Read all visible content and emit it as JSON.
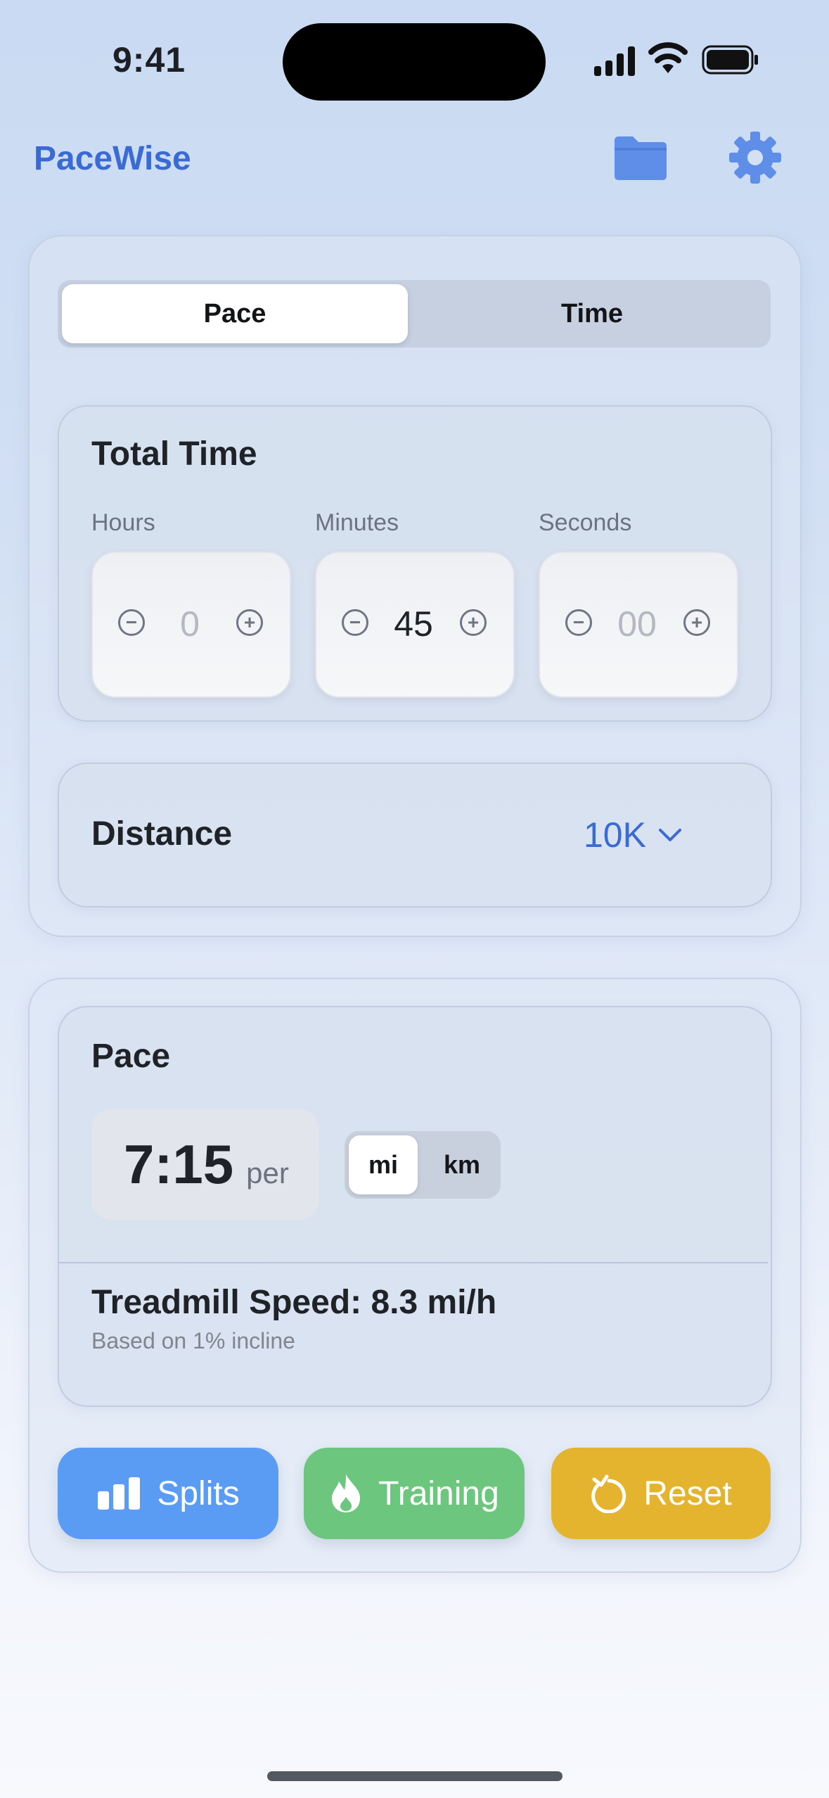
{
  "status": {
    "time": "9:41"
  },
  "header": {
    "app_title": "PaceWise",
    "folder_icon": "folder-icon",
    "settings_icon": "gear-icon"
  },
  "mode_tabs": [
    {
      "label": "Pace",
      "selected": true
    },
    {
      "label": "Time",
      "selected": false
    }
  ],
  "total_time": {
    "title": "Total Time",
    "fields": [
      {
        "label": "Hours",
        "value": "0",
        "placeholder": true
      },
      {
        "label": "Minutes",
        "value": "45",
        "placeholder": false
      },
      {
        "label": "Seconds",
        "value": "00",
        "placeholder": true
      }
    ]
  },
  "distance": {
    "label": "Distance",
    "value": "10K"
  },
  "result": {
    "title": "Pace",
    "pace_value": "7:15",
    "pace_suffix": "per",
    "units": [
      {
        "label": "mi",
        "selected": true
      },
      {
        "label": "km",
        "selected": false
      }
    ],
    "treadmill": "Treadmill Speed: 8.3 mi/h",
    "treadmill_note": "Based on 1% incline"
  },
  "actions": [
    {
      "label": "Splits",
      "icon": "bar-chart-icon",
      "color": "#5a9cf4"
    },
    {
      "label": "Training",
      "icon": "flame-icon",
      "color": "#6cc67e"
    },
    {
      "label": "Reset",
      "icon": "reset-icon",
      "color": "#e4b42e"
    }
  ],
  "colors": {
    "accent": "#3a6ad4",
    "distance_value": "#3a6ad4"
  }
}
